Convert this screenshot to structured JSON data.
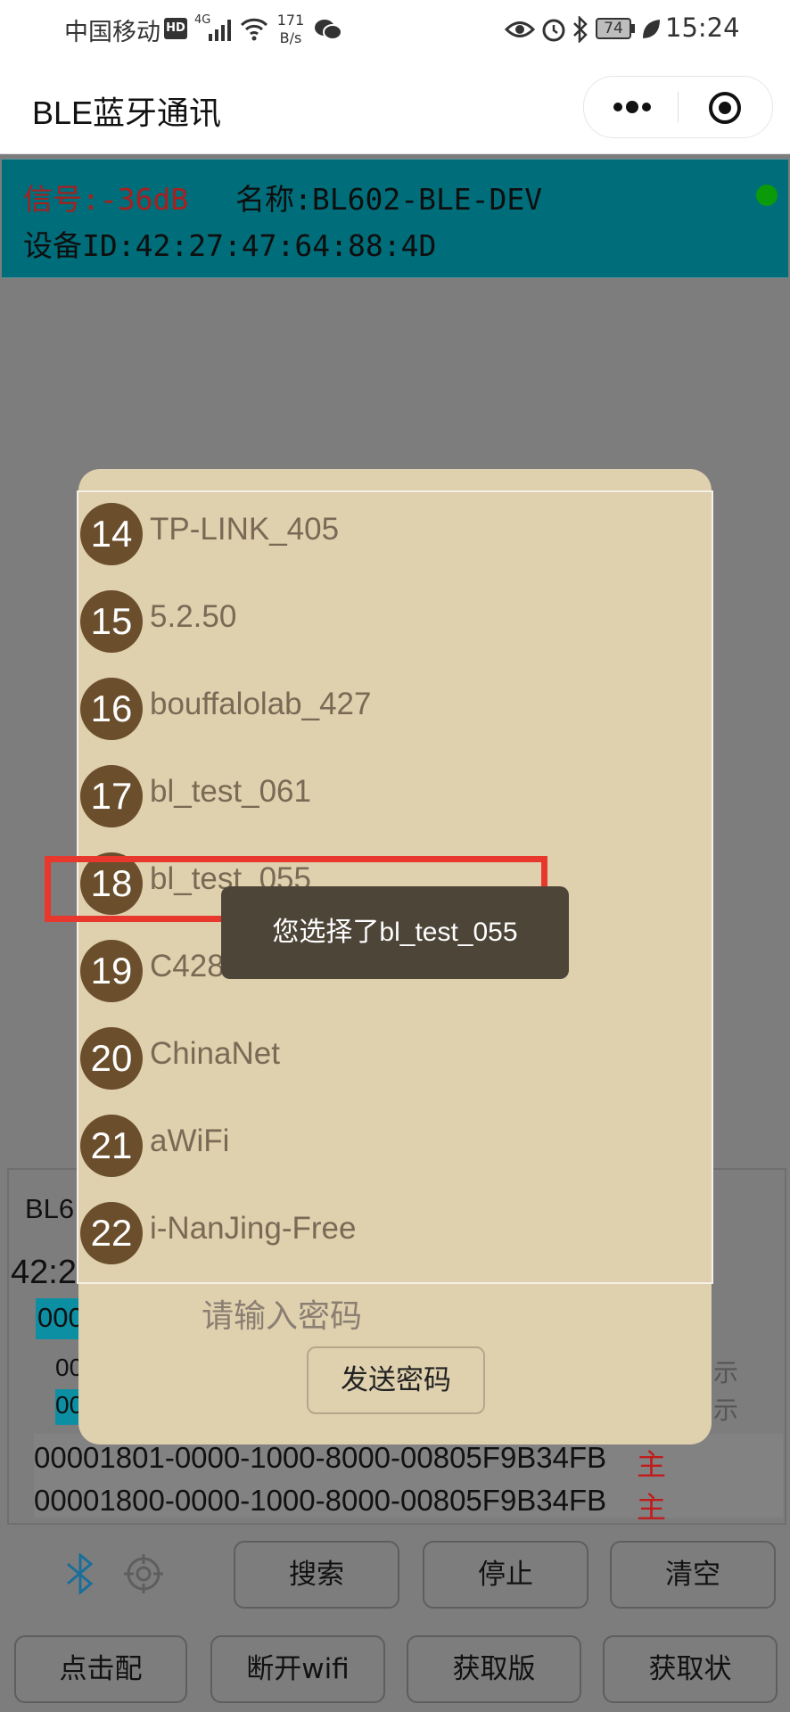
{
  "status_bar": {
    "carrier": "中国移动",
    "hd": "HD",
    "net": "4G",
    "speed_top": "171",
    "speed_bottom": "B/s",
    "battery": "74",
    "time": "15:24"
  },
  "nav": {
    "title": "BLE蓝牙通讯"
  },
  "device": {
    "signal": "信号:-36dB",
    "name": "名称:BL602-BLE-DEV",
    "id": "设备ID:42:27:47:64:88:4D",
    "status_color": "#0a9a0a"
  },
  "background_list": {
    "device_name_partial": "BL6",
    "device_id_partial": "42:2",
    "row_00_a": "000",
    "row_00_b": "00",
    "row_00_c": "00",
    "tail_1": "示",
    "tail_2": "示",
    "service_1": "00001801-0000-1000-8000-00805F9B34FB",
    "service_1_tag": "主",
    "service_2": "00001800-0000-1000-8000-00805F9B34FB",
    "service_2_tag": "主"
  },
  "buttons_row1": {
    "search": "搜索",
    "stop": "停止",
    "clear": "清空"
  },
  "buttons_row2": {
    "pair": "点击配",
    "disconnect_wifi": "断开wifi",
    "get_version": "获取版",
    "get_status": "获取状"
  },
  "modal": {
    "wifi_list": [
      {
        "num": "14",
        "ssid": "TP-LINK_405"
      },
      {
        "num": "15",
        "ssid": "5.2.50"
      },
      {
        "num": "16",
        "ssid": "bouffalolab_427"
      },
      {
        "num": "17",
        "ssid": "bl_test_061"
      },
      {
        "num": "18",
        "ssid": "bl_test_055"
      },
      {
        "num": "19",
        "ssid": "C428"
      },
      {
        "num": "20",
        "ssid": "ChinaNet"
      },
      {
        "num": "21",
        "ssid": "aWiFi"
      },
      {
        "num": "22",
        "ssid": "i-NanJing-Free"
      }
    ],
    "password_placeholder": "请输入密码",
    "send_button": "发送密码"
  },
  "toast": {
    "text": "您选择了bl_test_055"
  },
  "colors": {
    "accent_teal": "#006d7a",
    "highlight_red": "#e8382e",
    "modal_bg": "#dfd0ae",
    "badge_brown": "#6b4e2c"
  },
  "icons": [
    "hd-icon",
    "signal-icon",
    "wifi-icon",
    "wechat-icon",
    "eye-icon",
    "alarm-icon",
    "bluetooth-icon",
    "battery-icon",
    "leaf-icon",
    "more-dots-icon",
    "target-icon",
    "bluetooth-icon",
    "crosshair-icon"
  ]
}
